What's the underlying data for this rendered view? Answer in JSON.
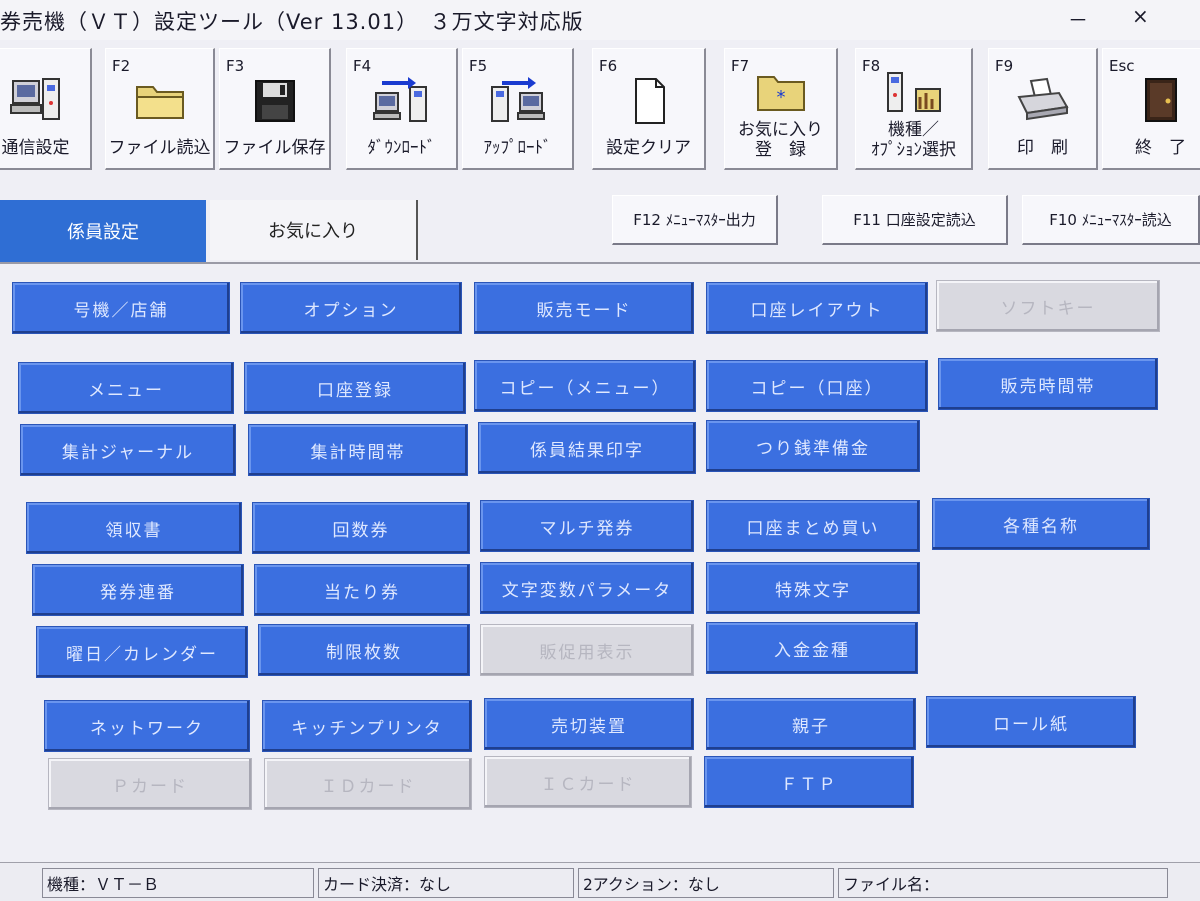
{
  "window": {
    "title": "券売機（ＶＴ）設定ツール（Ver 13.01）　３万文字対応版",
    "minimize": "－",
    "close": "×"
  },
  "toolbar": [
    {
      "key": "",
      "label": "通信設定",
      "icon": "terminal-icon"
    },
    {
      "key": "F2",
      "label": "ファイル読込",
      "icon": "folder-icon"
    },
    {
      "key": "F3",
      "label": "ファイル保存",
      "icon": "floppy-icon"
    },
    {
      "key": "F4",
      "label": "ﾀﾞｳﾝﾛｰﾄﾞ",
      "icon": "download-icon"
    },
    {
      "key": "F5",
      "label": "ｱｯﾌﾟﾛｰﾄﾞ",
      "icon": "upload-icon"
    },
    {
      "key": "F6",
      "label": "設定クリア",
      "icon": "blank-page-icon"
    },
    {
      "key": "F7",
      "label": "お気に入り\n登　録",
      "icon": "favorite-folder-icon"
    },
    {
      "key": "F8",
      "label": "機種／\nｵﾌﾟｼｮﾝ選択",
      "icon": "model-select-icon"
    },
    {
      "key": "F9",
      "label": "印　刷",
      "icon": "printer-icon"
    },
    {
      "key": "Esc",
      "label": "終　了",
      "icon": "exit-door-icon"
    }
  ],
  "tabs": {
    "active": "係員設定",
    "inactive": "お気に入り"
  },
  "right_buttons": [
    "F12 ﾒﾆｭｰﾏｽﾀｰ出力",
    "F11 口座設定読込",
    "F10 ﾒﾆｭｰﾏｽﾀｰ読込"
  ],
  "grid_buttons": [
    {
      "label": "号機／店舗",
      "enabled": true
    },
    {
      "label": "オプション",
      "enabled": true
    },
    {
      "label": "販売モード",
      "enabled": true
    },
    {
      "label": "口座レイアウト",
      "enabled": true
    },
    {
      "label": "ソフトキー",
      "enabled": false
    },
    {
      "label": "メニュー",
      "enabled": true
    },
    {
      "label": "口座登録",
      "enabled": true
    },
    {
      "label": "コピー（メニュー）",
      "enabled": true
    },
    {
      "label": "コピー（口座）",
      "enabled": true
    },
    {
      "label": "販売時間帯",
      "enabled": true
    },
    {
      "label": "集計ジャーナル",
      "enabled": true
    },
    {
      "label": "集計時間帯",
      "enabled": true
    },
    {
      "label": "係員結果印字",
      "enabled": true
    },
    {
      "label": "つり銭準備金",
      "enabled": true
    },
    {
      "label": "領収書",
      "enabled": true
    },
    {
      "label": "回数券",
      "enabled": true
    },
    {
      "label": "マルチ発券",
      "enabled": true
    },
    {
      "label": "口座まとめ買い",
      "enabled": true
    },
    {
      "label": "各種名称",
      "enabled": true
    },
    {
      "label": "発券連番",
      "enabled": true
    },
    {
      "label": "当たり券",
      "enabled": true
    },
    {
      "label": "文字変数パラメータ",
      "enabled": true
    },
    {
      "label": "特殊文字",
      "enabled": true
    },
    {
      "label": "曜日／カレンダー",
      "enabled": true
    },
    {
      "label": "制限枚数",
      "enabled": true
    },
    {
      "label": "販促用表示",
      "enabled": false
    },
    {
      "label": "入金金種",
      "enabled": true
    },
    {
      "label": "ネットワーク",
      "enabled": true
    },
    {
      "label": "キッチンプリンタ",
      "enabled": true
    },
    {
      "label": "売切装置",
      "enabled": true
    },
    {
      "label": "親子",
      "enabled": true
    },
    {
      "label": "ロール紙",
      "enabled": true
    },
    {
      "label": "Ｐカード",
      "enabled": false
    },
    {
      "label": "ＩＤカード",
      "enabled": false
    },
    {
      "label": "ＩＣカード",
      "enabled": false
    },
    {
      "label": "ＦＴＰ",
      "enabled": true
    }
  ],
  "status": {
    "model": "機種：ＶＴ－Ｂ",
    "card": "カード決済：なし",
    "action": "2アクション：なし",
    "file": "ファイル名："
  }
}
